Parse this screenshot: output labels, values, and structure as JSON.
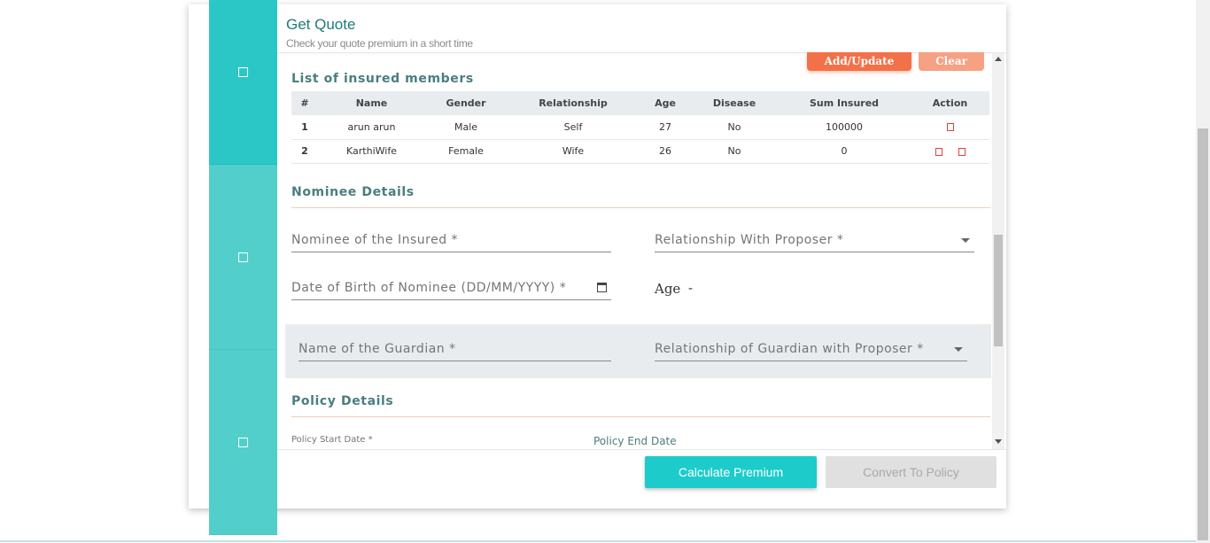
{
  "header": {
    "title": "Get Quote",
    "subtitle": "Check your quote premium in a short time"
  },
  "actions": {
    "add_update": "Add/Update",
    "clear": "Clear"
  },
  "insured": {
    "title": "List of insured members",
    "columns": [
      "#",
      "Name",
      "Gender",
      "Relationship",
      "Age",
      "Disease",
      "Sum Insured",
      "Action"
    ],
    "rows": [
      {
        "idx": "1",
        "name": "arun arun",
        "gender": "Male",
        "relationship": "Self",
        "age": "27",
        "disease": "No",
        "sum_insured": "100000"
      },
      {
        "idx": "2",
        "name": "KarthiWife",
        "gender": "Female",
        "relationship": "Wife",
        "age": "26",
        "disease": "No",
        "sum_insured": "0"
      }
    ]
  },
  "nominee": {
    "title": "Nominee Details",
    "name_label": "Nominee of the Insured *",
    "relationship_label": "Relationship With Proposer *",
    "dob_label": "Date of Birth of Nominee (DD/MM/YYYY) *",
    "age_label": "Age",
    "age_value": "-",
    "guardian_name_label": "Name of the Guardian *",
    "guardian_relationship_label": "Relationship of Guardian with Proposer *"
  },
  "policy": {
    "title": "Policy Details",
    "start_label": "Policy Start Date *",
    "end_label": "Policy End Date"
  },
  "footer": {
    "calculate": "Calculate Premium",
    "convert": "Convert To Policy"
  },
  "colors": {
    "accent": "#2bc7c7",
    "primary_button": "#1ecbcb",
    "add_button": "#f27148",
    "clear_button": "#f6a184",
    "section_title": "#4b7d80"
  }
}
